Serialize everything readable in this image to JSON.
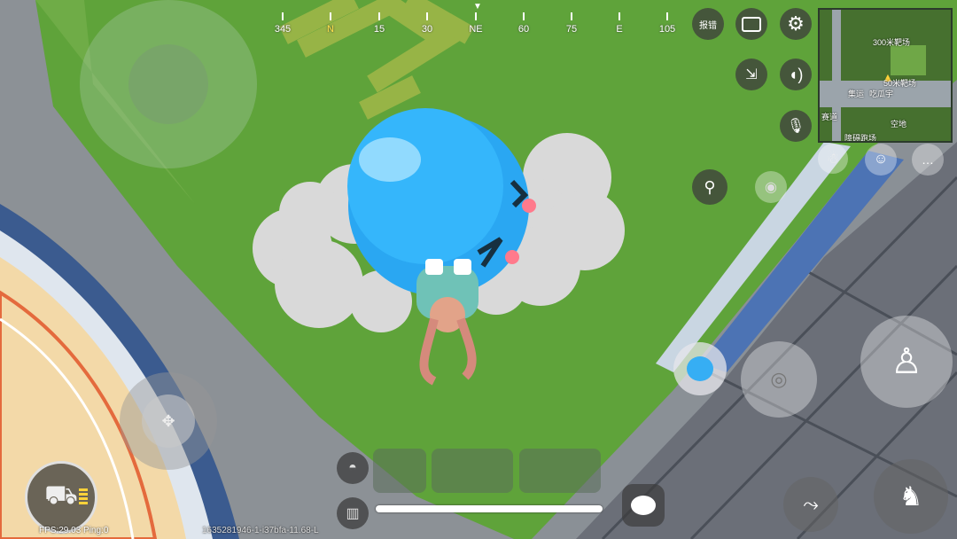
{
  "compass": {
    "marks": [
      {
        "label": "345",
        "cardinal": false
      },
      {
        "label": "N",
        "cardinal": true
      },
      {
        "label": "15",
        "cardinal": false
      },
      {
        "label": "30",
        "cardinal": false
      },
      {
        "label": "NE",
        "cardinal": false
      },
      {
        "label": "60",
        "cardinal": false
      },
      {
        "label": "75",
        "cardinal": false
      },
      {
        "label": "E",
        "cardinal": false
      },
      {
        "label": "105",
        "cardinal": false
      }
    ],
    "heading_marker": "▼"
  },
  "top_controls": {
    "report_label": "报错",
    "camera_icon": "camera-icon",
    "settings_icon": "gear-icon"
  },
  "side_controls": {
    "exit_icon": "exit-vehicle-icon",
    "sound_icon": "speaker-icon",
    "mic_icon": "microphone-off-icon",
    "location_icon": "location-pin-icon",
    "view_icon": "eye-icon"
  },
  "minimap": {
    "labels": [
      "300米靶场",
      "50米靶场",
      "集运",
      "吃瓜宇",
      "空地",
      "赛道",
      "障碍跑场"
    ]
  },
  "social": {
    "emote_icon": "character-face-icon",
    "chat_icon": "chat-bubble-icon"
  },
  "actions": {
    "jump_icon": "jump-pose-icon",
    "crouch_icon": "crouch-pose-icon",
    "prone_icon": "prone-pose-icon",
    "vehicle_icon": "balloon-slime-icon"
  },
  "inventory": {
    "helmet_icon": "helmet-icon",
    "vest_icon": "vest-icon",
    "backpack_icon": "backpack-icon",
    "message_icon": "speech-bubble-icon"
  },
  "status": {
    "fps_text": "FPS:29.03 Ping:0",
    "build_text": "1635281946-1-i37bfa-11.68-L"
  },
  "colors": {
    "grass": "#5fa33a",
    "road": "#8d9296",
    "balloon": "#2aa7f2",
    "accent_yellow": "#ffe24a"
  }
}
